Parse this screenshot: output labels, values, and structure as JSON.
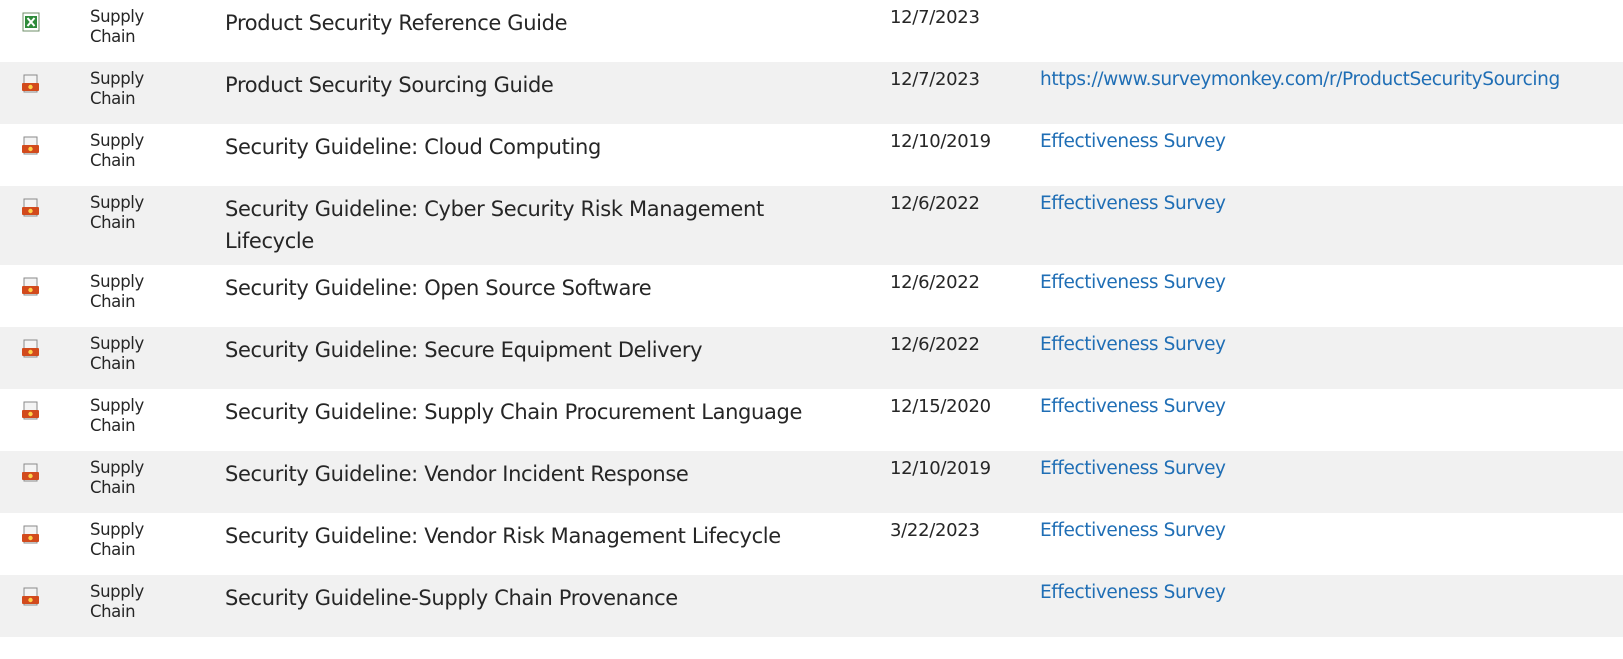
{
  "colors": {
    "link": "#1f6eb5",
    "row_alt_bg": "#f1f1f1",
    "text": "#262626"
  },
  "documents": [
    {
      "icon": "excel-file-icon",
      "category": "Supply Chain",
      "title": "Product Security Reference Guide",
      "date": "12/7/2023",
      "link": ""
    },
    {
      "icon": "pdf-file-icon",
      "category": "Supply Chain",
      "title": "Product Security Sourcing Guide",
      "date": "12/7/2023",
      "link": "https://www.surveymonkey.com/r/ProductSecuritySourcing"
    },
    {
      "icon": "pdf-file-icon",
      "category": "Supply Chain",
      "title": "Security Guideline: Cloud Computing",
      "date": "12/10/2019",
      "link": "Effectiveness Survey"
    },
    {
      "icon": "pdf-file-icon",
      "category": "Supply Chain",
      "title": "Security Guideline: Cyber Security Risk Management Lifecycle",
      "date": "12/6/2022",
      "link": "Effectiveness Survey"
    },
    {
      "icon": "pdf-file-icon",
      "category": "Supply Chain",
      "title": "Security Guideline: Open Source Software",
      "date": "12/6/2022",
      "link": "Effectiveness Survey"
    },
    {
      "icon": "pdf-file-icon",
      "category": "Supply Chain",
      "title": "Security Guideline: Secure Equipment Delivery",
      "date": "12/6/2022",
      "link": "Effectiveness Survey"
    },
    {
      "icon": "pdf-file-icon",
      "category": "Supply Chain",
      "title": "Security Guideline: Supply Chain Procurement Language",
      "date": "12/15/2020",
      "link": "Effectiveness Survey"
    },
    {
      "icon": "pdf-file-icon",
      "category": "Supply Chain",
      "title": "Security Guideline: Vendor Incident Response",
      "date": "12/10/2019",
      "link": "Effectiveness Survey"
    },
    {
      "icon": "pdf-file-icon",
      "category": "Supply Chain",
      "title": "Security Guideline: Vendor Risk Management Lifecycle",
      "date": "3/22/2023",
      "link": "Effectiveness Survey"
    },
    {
      "icon": "pdf-file-icon",
      "category": "Supply Chain",
      "title": "Security Guideline-Supply Chain Provenance",
      "date": "",
      "link": "Effectiveness Survey"
    }
  ]
}
